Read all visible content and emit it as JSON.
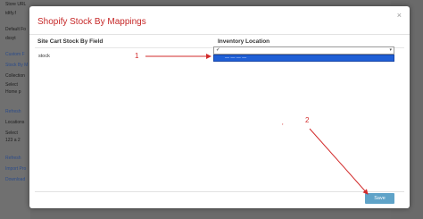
{
  "background": {
    "sidebar_items": [
      {
        "label": "Store URL",
        "link": false
      },
      {
        "label": "tdtfy.f",
        "link": false
      },
      {
        "label": "Default Fo",
        "link": false
      },
      {
        "label": "dssyt",
        "link": false
      },
      {
        "label": "Custom F",
        "link": true
      },
      {
        "label": "Stock By M",
        "link": true
      },
      {
        "label": "Collection",
        "link": false
      },
      {
        "label": "Select",
        "link": false
      },
      {
        "label": "Home p",
        "link": false
      },
      {
        "label": "Refresh",
        "link": true
      },
      {
        "label": "Locations",
        "link": false
      },
      {
        "label": "Select",
        "link": false
      },
      {
        "label": "123 a 2",
        "link": false
      },
      {
        "label": "Refresh",
        "link": true
      },
      {
        "label": "Import Pro",
        "link": true
      },
      {
        "label": "Download",
        "link": true
      }
    ]
  },
  "modal": {
    "title": "Shopify Stock By Mappings",
    "close_label": "×",
    "columns": [
      "Site Cart Stock By Field",
      "Inventory Location"
    ],
    "rows": [
      {
        "field": "stock",
        "selected_value": "✓",
        "highlighted_option": "— — — —"
      }
    ],
    "save_label": "Save"
  },
  "annotations": {
    "marker_1": "1",
    "marker_2": "2",
    "stray_mark": "‚",
    "color": "#d22b2b"
  }
}
